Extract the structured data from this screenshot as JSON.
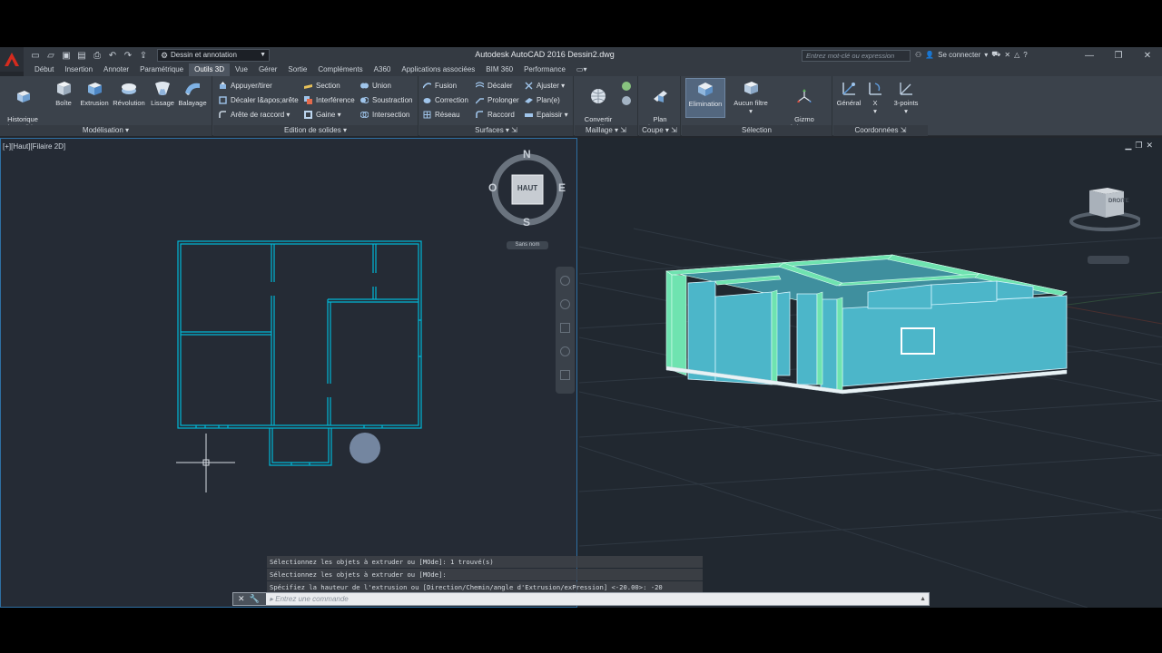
{
  "titlebar": {
    "workspace": "Dessin et annotation",
    "title": "Autodesk AutoCAD 2016   Dessin2.dwg",
    "search_placeholder": "Entrez mot-clé ou expression",
    "signin": "Se connecter"
  },
  "tabs": [
    "Début",
    "Insertion",
    "Annoter",
    "Paramétrique",
    "Outils 3D",
    "Vue",
    "Gérer",
    "Sortie",
    "Compléments",
    "A360",
    "Applications associées",
    "BIM 360",
    "Performance"
  ],
  "ribbon": {
    "modelisation": {
      "title": "Modélisation",
      "historique": "Historique\ndes solides",
      "boite": "Boîte",
      "extrusion": "Extrusion",
      "revolution": "Révolution",
      "lissage": "Lissage",
      "balayage": "Balayage"
    },
    "edition": {
      "title": "Edition de solides",
      "appuyer": "Appuyer/tirer",
      "decaler_arete": "Décaler l&apos;arête",
      "arete_raccord": "Arête de raccord",
      "section": "Section",
      "interference": "Interférence",
      "gaine": "Gaine",
      "union": "Union",
      "soustraction": "Soustraction",
      "intersection": "Intersection"
    },
    "surfaces": {
      "title": "Surfaces",
      "fusion": "Fusion",
      "correction": "Correction",
      "reseau": "Réseau",
      "decaler": "Décaler",
      "prolonger": "Prolonger",
      "raccord": "Raccord",
      "ajuster": "Ajuster",
      "plan": "Plan(e)",
      "epaissir": "Epaissir"
    },
    "maillage": {
      "title": "Maillage",
      "convertir": "Convertir\nen maillage"
    },
    "coupe": {
      "title": "Coupe",
      "plan_coupe": "Plan\nde coupe"
    },
    "selection": {
      "title": "Sélection",
      "elimination": "Elimination",
      "aucun_filtre": "Aucun filtre",
      "gizmo": "Gizmo\nDéplacement"
    },
    "coordonnees": {
      "title": "Coordonnées",
      "general": "Général",
      "x": "X",
      "trois_points": "3-points"
    }
  },
  "viewport_left": {
    "label": "[+][Haut][Filaire 2D]",
    "cube_face": "HAUT",
    "north": "N",
    "south": "S",
    "east": "E",
    "west": "O",
    "ucs_name": "Sans nom"
  },
  "viewport_right": {
    "cube_face": "DROITE"
  },
  "command": {
    "history": [
      "Sélectionnez les objets à extruder ou [MOde]: 1 trouvé(s)",
      "Sélectionnez les objets à extruder ou [MOde]:",
      "Spécifiez la hauteur de l'extrusion ou [Direction/Chemin/angle d'Extrusion/exPression] <-20.00>: -20"
    ],
    "prompt": "Entrez une commande"
  },
  "colors": {
    "wire": "#00b7d6",
    "wall_side": "#4cb6c9",
    "wall_top": "#6fe3b0",
    "accent": "#2f6fa3"
  }
}
